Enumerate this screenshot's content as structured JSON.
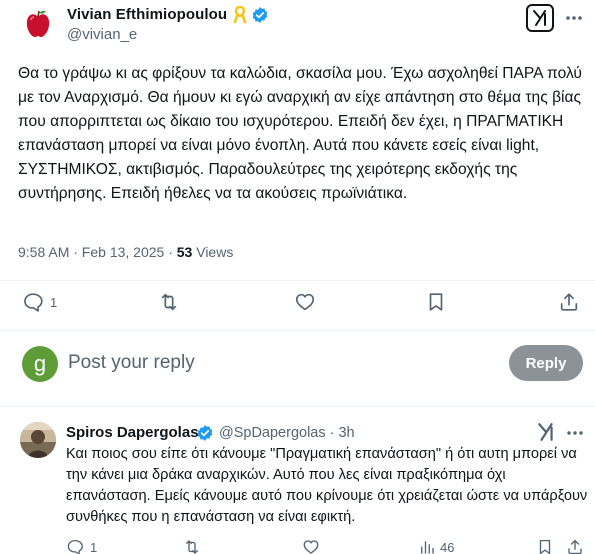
{
  "post": {
    "author_name": "Vivian Efthimiopoulou",
    "handle": "@vivian_e",
    "text": "Θα το γράψω κι ας φρίξουν τα καλώδια, σκασίλα μου. Έχω ασχοληθεί ΠΑΡΑ πολύ με τον Αναρχισμό. Θα ήμουν κι εγώ αναρχική αν είχε απάντηση στο θέμα της βίας που απορριπτεται ως δίκαιο του ισχυρότερου. Επειδή δεν έχει, η ΠΡΑΓΜΑΤΙΚΗ επανάσταση μπορεί να είναι μόνο ένοπλη. Αυτά που κάνετε εσείς είναι light, ΣΥΣΤΗΜΙΚΟΣ, ακτιβισμός. Παραδουλεύτρες της χειρότερης εκδοχής της συντήρησης. Επειδή ήθελες να τα ακούσεις πρωϊνιάτικα.",
    "time": "9:58 AM · Feb 13, 2025 · ",
    "views_count": "53",
    "views_label": " Views",
    "actions": {
      "reply_count": "1",
      "repost_count": "",
      "like_count": ""
    }
  },
  "reply_box": {
    "avatar_letter": "g",
    "placeholder": "Post your reply",
    "button_label": "Reply"
  },
  "comment": {
    "author_name": "Spiros Dapergolas",
    "handle_time": "@SpDapergolas · 3h",
    "text": "Και ποιος σου είπε ότι κάνουμε \"Πραγματική επανάσταση\" ή ότι αυτη μπορεί να την κάνει μια δράκα αναρχικών. Αυτό που λες είναι πραξικόπημα όχι επανάσταση. Εμείς κάνουμε αυτό που κρίνουμε ότι χρειάζεται ώστε να υπάρξουν συνθήκες που η επανάσταση να είναι εφικτή.",
    "reply_count": "1",
    "views_count": "46"
  },
  "colors": {
    "verified_blue": "#1d9bf0",
    "ribbon_gold": "#f5c518",
    "muted_text": "#536471",
    "reply_button_bg": "#8b9399",
    "avatar_green": "#5e9c37"
  },
  "icons": [
    "apple-avatar-icon",
    "ribbon-icon",
    "verified-badge-icon",
    "grok-icon",
    "more-icon",
    "reply-icon",
    "repost-icon",
    "like-icon",
    "bookmark-icon",
    "share-icon",
    "views-icon"
  ]
}
